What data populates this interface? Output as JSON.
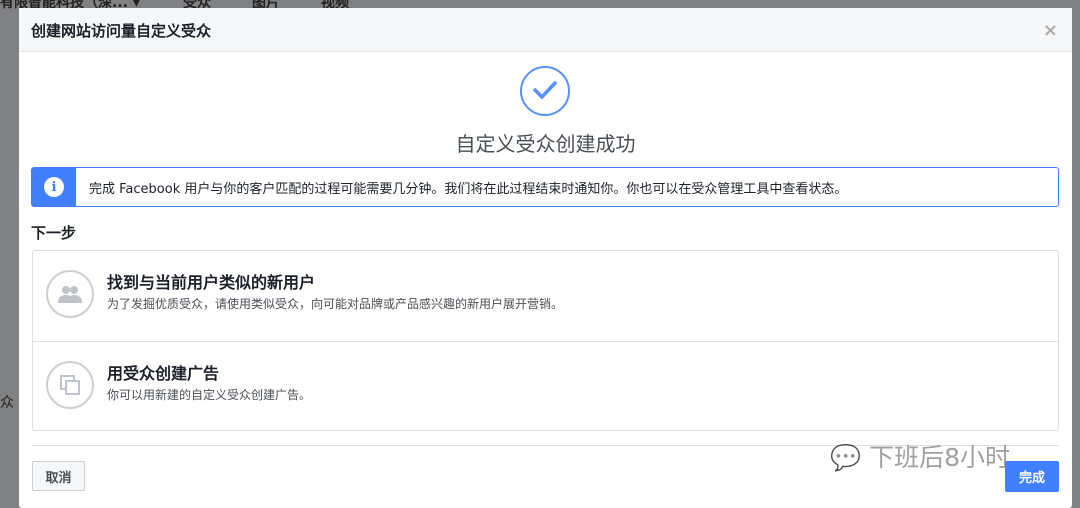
{
  "background": {
    "account": "有限智能科技（深... ▾",
    "tabs": [
      "受众",
      "图片",
      "视频"
    ],
    "side_text": "众"
  },
  "modal": {
    "title": "创建网站访问量自定义受众",
    "close_label": "×",
    "success_title": "自定义受众创建成功",
    "info_text": "完成 Facebook 用户与你的客户匹配的过程可能需要几分钟。我们将在此过程结束时通知你。你也可以在受众管理工具中查看状态。",
    "next_heading": "下一步",
    "cards": [
      {
        "title": "找到与当前用户类似的新用户",
        "desc": "为了发掘优质受众，请使用类似受众，向可能对品牌或产品感兴趣的新用户展开营销。",
        "icon": "people-icon"
      },
      {
        "title": "用受众创建广告",
        "desc": "你可以用新建的自定义受众创建广告。",
        "icon": "ad-copy-icon"
      }
    ],
    "cancel_label": "取消",
    "done_label": "完成"
  },
  "watermark": "下班后8小时",
  "colors": {
    "accent": "#4080ff"
  }
}
